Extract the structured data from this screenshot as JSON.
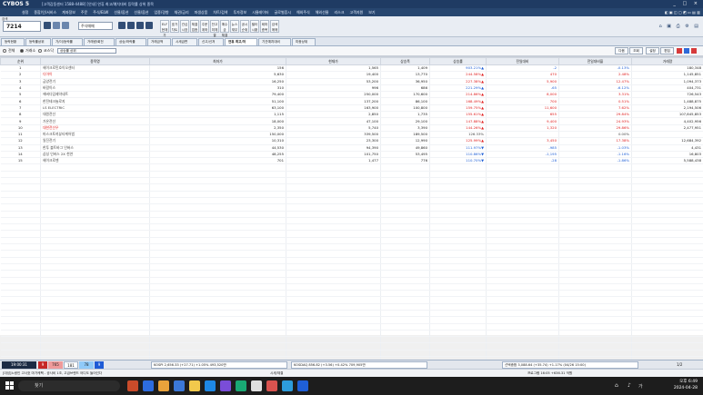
{
  "titlebar": {
    "app": "CYBOS 5",
    "subtitle": "[고객감동센터 1588-4488]  [안내] 연휴 최고/예치대비 등락률 상위 종목",
    "window_controls": "_ □ ×"
  },
  "menubar": {
    "items": [
      "설정",
      "종합/인/서비스",
      "계좌정보",
      "주문",
      "주식/ELW",
      "선물/옵션",
      "선물/옵션",
      "업종/경향",
      "채권/금리",
      "파생상품",
      "차트/검색",
      "투자정보",
      "시뮬레이터",
      "글로벌증시",
      "해외주식",
      "해외선물",
      "리스크",
      "고객지원",
      "보기"
    ],
    "right_icons": "◧ ▣ ◫ ▢ ◩ ▭ ▤ ▥"
  },
  "toolbar": {
    "code_label": "검색",
    "code_value": "7214",
    "combo": "주식매매",
    "buttons": [
      "ELF",
      "현재가",
      "호가",
      "차트",
      "관심",
      "시장",
      "체결",
      "업종",
      "주문",
      "계좌",
      "잔고",
      "미체결",
      "예수금",
      "체결",
      "뉴스",
      "재무",
      "공시",
      "순위",
      "필터",
      "시황",
      "테마",
      "종목",
      "검색",
      "매매"
    ],
    "right_icons": "⌂ ▣ ⎙ ⚙ ▤"
  },
  "tabs": [
    "등락현황",
    "등락률상위",
    "가/더/등락률",
    "거래량/회전",
    "상승/하락률",
    "거래금액",
    "시세급변",
    "신고/신저",
    "연휴 최고/저",
    "기관예치대비",
    "미종상위"
  ],
  "active_tab_index": 8,
  "filter": {
    "radio_all": "전체",
    "radio_kospi": "거래소",
    "radio_kosdaq": "코스닥",
    "select_value": "상승률 상위",
    "right_buttons": [
      "다음",
      "조회",
      "설정",
      "편집"
    ]
  },
  "table": {
    "headers": [
      "순위",
      "종목명",
      "최저가",
      "현재가",
      "상승폭",
      "상승률",
      "전일대비",
      "전일대비율",
      "거래량"
    ],
    "rows": [
      {
        "rank": "1",
        "name": "헤이크로민호이오센터",
        "low": "156",
        "cur": "1,565",
        "up": "1,409",
        "rate": "903.21%▲",
        "diff": "-2",
        "diffrate": "-0.13%",
        "vol": "180,348",
        "nameColor": "gray",
        "diffColor": "blue",
        "rateColor": "blue"
      },
      {
        "rank": "2",
        "name": "디아이",
        "low": "5,630",
        "cur": "19,400",
        "up": "13,770",
        "rate": "244.58%▲",
        "diff": "470",
        "diffrate": "2.48%",
        "vol": "1,145,851",
        "nameColor": "red",
        "diffColor": "red",
        "rateColor": "red"
      },
      {
        "rank": "3",
        "name": "금양전기",
        "low": "16,250",
        "cur": "53,200",
        "up": "36,950",
        "rate": "227.38%▲",
        "diff": "5,900",
        "diffrate": "12.47%",
        "vol": "1,094,373",
        "nameColor": "gray",
        "diffColor": "red",
        "rateColor": "red"
      },
      {
        "rank": "4",
        "name": "바람이스",
        "low": "310",
        "cur": "996",
        "up": "686",
        "rate": "221.29%▲",
        "diff": "-65",
        "diffrate": "-6.12%",
        "vol": "404,731",
        "nameColor": "gray",
        "diffColor": "blue",
        "rateColor": "blue"
      },
      {
        "rank": "5",
        "name": "에버다임제약네트",
        "low": "79,400",
        "cur": "250,000",
        "up": "170,600",
        "rate": "214.86%▲",
        "diff": "8,000",
        "diffrate": "3.31%",
        "vol": "726,543",
        "nameColor": "gray",
        "diffColor": "red",
        "rateColor": "red"
      },
      {
        "rank": "6",
        "name": "한전테크놀로지",
        "low": "51,100",
        "cur": "137,200",
        "up": "86,100",
        "rate": "168.49%▲",
        "diff": "700",
        "diffrate": "0.51%",
        "vol": "1,488,875",
        "nameColor": "gray",
        "diffColor": "red",
        "rateColor": "red"
      },
      {
        "rank": "7",
        "name": "LS ELECTRIC",
        "low": "63,100",
        "cur": "163,900",
        "up": "100,800",
        "rate": "159.75%▲",
        "diff": "11,600",
        "diffrate": "7.62%",
        "vol": "2,194,506",
        "nameColor": "gray",
        "diffColor": "red",
        "rateColor": "red"
      },
      {
        "rank": "8",
        "name": "대원전선",
        "low": "1,115",
        "cur": "2,850",
        "up": "1,735",
        "rate": "155.61%▲",
        "diff": "655",
        "diffrate": "29.84%",
        "vol": "107,845,853",
        "nameColor": "gray",
        "diffColor": "red",
        "rateColor": "red"
      },
      {
        "rank": "9",
        "name": "가온전선",
        "low": "18,000",
        "cur": "47,100",
        "up": "29,100",
        "rate": "147.88%▲",
        "diff": "9,400",
        "diffrate": "24.93%",
        "vol": "4,402,956",
        "nameColor": "gray",
        "diffColor": "red",
        "rateColor": "red"
      },
      {
        "rank": "10",
        "name": "대한전선우",
        "low": "2,350",
        "cur": "5,740",
        "up": "3,390",
        "rate": "144.26%▲",
        "diff": "1,320",
        "diffrate": "29.86%",
        "vol": "2,477,951",
        "nameColor": "red",
        "diffColor": "red",
        "rateColor": "red"
      },
      {
        "rank": "11",
        "name": "마스크토끼뷰티케어법",
        "low": "150,000",
        "cur": "339,500",
        "up": "189,500",
        "rate": "126.33%",
        "diff": "",
        "diffrate": "0.00%",
        "vol": "",
        "nameColor": "gray",
        "diffColor": "gray",
        "rateColor": "gray"
      },
      {
        "rank": "12",
        "name": "일진전기",
        "low": "10,310",
        "cur": "23,300",
        "up": "12,990",
        "rate": "125.99%▲",
        "diff": "3,450",
        "diffrate": "17.38%",
        "vol": "12,684,392",
        "nameColor": "gray",
        "diffColor": "red",
        "rateColor": "red"
      },
      {
        "rank": "13",
        "name": "한투 볼트바그 인버스",
        "low": "44,530",
        "cur": "94,390",
        "up": "49,860",
        "rate": "111.97%▼",
        "diff": "-985",
        "diffrate": "-1.03%",
        "vol": "4,431",
        "nameColor": "gray",
        "diffColor": "blue",
        "rateColor": "blue"
      },
      {
        "rank": "14",
        "name": "삼성 인버스 2X 천연",
        "low": "48,255",
        "cur": "101,750",
        "up": "53,495",
        "rate": "110.86%▼",
        "diff": "-1,195",
        "diffrate": "-1.16%",
        "vol": "16,803",
        "nameColor": "gray",
        "diffColor": "blue",
        "rateColor": "blue"
      },
      {
        "rank": "15",
        "name": "헤이크로젠",
        "low": "701",
        "cur": "1,477",
        "up": "776",
        "rate": "110.70%▼",
        "diff": "-28",
        "diffrate": "-1.86%",
        "vol": "5,588,438",
        "nameColor": "gray",
        "diffColor": "blue",
        "rateColor": "blue"
      }
    ]
  },
  "statusbar": {
    "time": "19:00:31",
    "box1": "9",
    "box2": "765",
    "box3": "181",
    "box4": "78",
    "box5": "9",
    "kospi": "KOSPI  2,656.33 (+27.71) +1.05% 493,520만",
    "kosdaq": "KOSDAQ  856.82 (+3.56) +0.42% 709,905만",
    "extra": "선택종합 3,088.64 (+35.74) +1.17% (04/26 15:00)",
    "page": "1/2"
  },
  "ticker": {
    "left": "[대성]노랑인 고사호 마가케팩 - 공사비 1조, 고급브랜드 어디도 들어선다",
    "mid": "시세/체결",
    "right": "프로그램  16:05 +636.31 억원"
  },
  "taskbar": {
    "search": "찾기",
    "time": "오후 6:49",
    "date": "2024-04-28",
    "lang": "가",
    "apps": [
      "#c94b2a",
      "#2d6cdf",
      "#e9a23b",
      "#3b78d8",
      "#f2c94c",
      "#1e88e5",
      "#7a4dd8",
      "#19a974",
      "#e0e0e0",
      "#d9534f",
      "#2d9cdb",
      "#1f5fd6"
    ]
  }
}
